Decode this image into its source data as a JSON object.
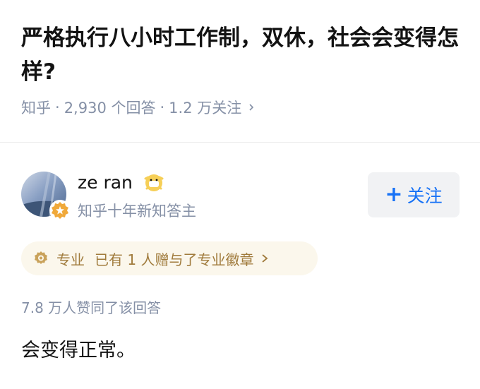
{
  "question": {
    "title": "严格执行八小时工作制，双休，社会会变得怎样?",
    "source": "知乎",
    "answer_count": "2,930 个回答",
    "follower_count": "1.2 万关注",
    "separator": "·"
  },
  "author": {
    "name": "ze ran",
    "description": "知乎十年新知答主",
    "follow_label": "关注",
    "follow_plus": "+"
  },
  "professional_badge": {
    "tag": "专业",
    "text": "已有 1 人赠与了专业徽章"
  },
  "answer": {
    "upvote_text": "7.8 万人赞同了该回答",
    "body": "会变得正常。"
  },
  "colors": {
    "accent": "#1772f6",
    "meta_gray": "#8590a6",
    "badge_gold": "#a07b3c",
    "badge_bg": "#fbf7ec"
  },
  "icons": [
    "chevron-right-icon",
    "avatar-badge-icon",
    "emoji-icon",
    "pro-badge-icon",
    "chevron-right-icon"
  ]
}
